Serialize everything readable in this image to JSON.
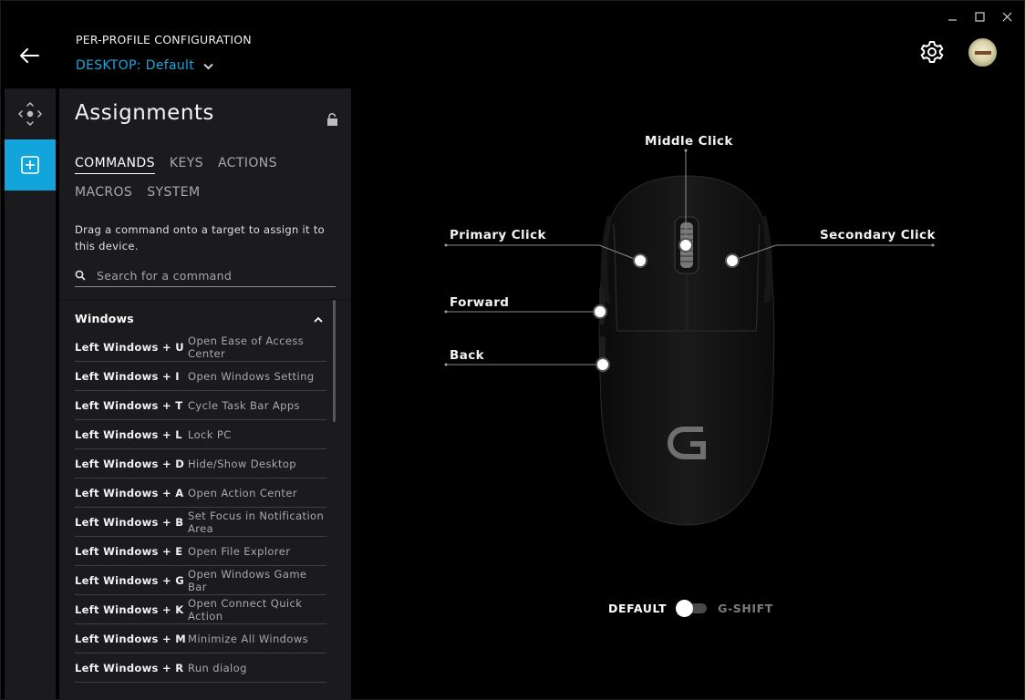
{
  "header": {
    "title": "PER-PROFILE CONFIGURATION",
    "profile_prefix": "DESKTOP:",
    "profile_name": "Default"
  },
  "panel": {
    "title": "Assignments",
    "tabs_row1": [
      "COMMANDS",
      "KEYS",
      "ACTIONS"
    ],
    "tabs_row2": [
      "MACROS",
      "SYSTEM"
    ],
    "active_tab": "COMMANDS",
    "description": "Drag a command onto a target to assign it to this device.",
    "search_placeholder": "Search for a command",
    "section_title": "Windows",
    "commands": [
      {
        "key": "Left Windows + U",
        "desc": "Open Ease of Access Center"
      },
      {
        "key": "Left Windows + I",
        "desc": "Open Windows Setting"
      },
      {
        "key": "Left Windows + T",
        "desc": "Cycle Task Bar Apps"
      },
      {
        "key": "Left Windows + L",
        "desc": "Lock PC"
      },
      {
        "key": "Left Windows + D",
        "desc": "Hide/Show Desktop"
      },
      {
        "key": "Left Windows + A",
        "desc": "Open Action Center"
      },
      {
        "key": "Left Windows + B",
        "desc": "Set Focus in Notification Area"
      },
      {
        "key": "Left Windows + E",
        "desc": "Open File Explorer"
      },
      {
        "key": "Left Windows + G",
        "desc": "Open Windows Game Bar"
      },
      {
        "key": "Left Windows + K",
        "desc": "Open Connect Quick Action"
      },
      {
        "key": "Left Windows + M",
        "desc": "Minimize All Windows"
      },
      {
        "key": "Left Windows + R",
        "desc": "Run dialog"
      }
    ]
  },
  "mouse": {
    "middle": "Middle Click",
    "primary": "Primary Click",
    "secondary": "Secondary Click",
    "forward": "Forward",
    "back": "Back"
  },
  "mode": {
    "default_label": "DEFAULT",
    "gshift_label": "G-SHIFT"
  },
  "colors": {
    "accent": "#12a5dc",
    "panel_bg": "#1b1b1d"
  }
}
